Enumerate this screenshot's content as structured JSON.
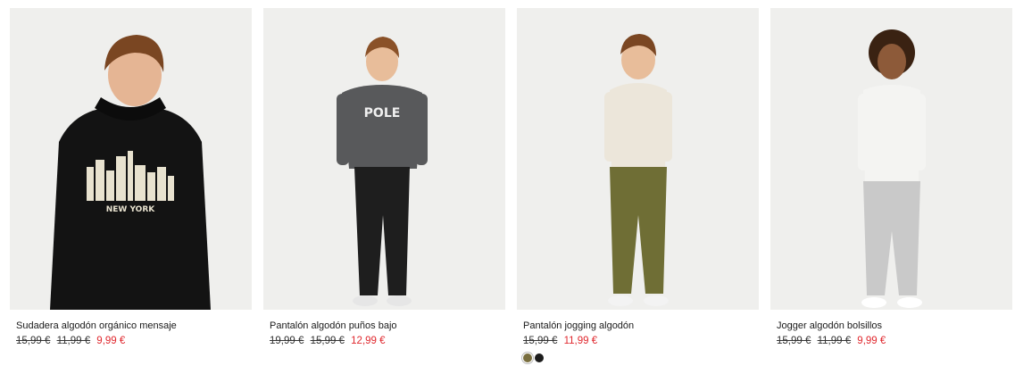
{
  "products": [
    {
      "name": "Sudadera algodón orgánico mensaje",
      "prices_old": [
        "15,99 €",
        "11,99 €"
      ],
      "price_sale": "9,99 €",
      "print_text": "NEW YORK",
      "image_desc": "boy-in-black-hoodie-icon"
    },
    {
      "name": "Pantalón algodón puños bajo",
      "prices_old": [
        "19,99 €",
        "15,99 €"
      ],
      "price_sale": "12,99 €",
      "print_text": "POLE",
      "image_desc": "boy-in-black-trousers-icon"
    },
    {
      "name": "Pantalón jogging algodón",
      "prices_old": [
        "15,99 €"
      ],
      "price_sale": "11,99 €",
      "swatches": [
        "#7a6f3f",
        "#1c1c1c"
      ],
      "image_desc": "boy-in-khaki-joggers-icon"
    },
    {
      "name": "Jogger algodón bolsillos",
      "prices_old": [
        "15,99 €",
        "11,99 €"
      ],
      "price_sale": "9,99 €",
      "image_desc": "boy-in-grey-joggers-icon"
    }
  ],
  "colors": {
    "sale": "#e0282e",
    "photo_bg": "#eeeeec"
  }
}
